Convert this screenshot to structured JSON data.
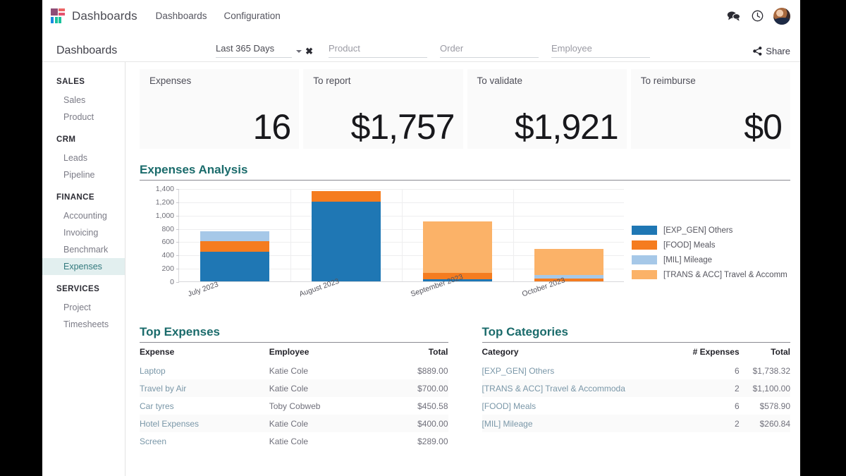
{
  "topbar": {
    "logo_icon": "dashboards-logo-icon",
    "brand": "Dashboards",
    "menu": [
      {
        "label": "Dashboards"
      },
      {
        "label": "Configuration"
      }
    ],
    "icons": [
      {
        "name": "messages-icon",
        "glyph": "speech-bubbles"
      },
      {
        "name": "activity-clock-icon",
        "glyph": "clock"
      }
    ],
    "avatar": "user-avatar"
  },
  "controlbar": {
    "page_title": "Dashboards",
    "filters": [
      {
        "name": "date-range",
        "value": "Last 365 Days",
        "caret": "chevron-down-icon",
        "clear": "✖"
      },
      {
        "name": "product",
        "placeholder": "Product"
      },
      {
        "name": "order",
        "placeholder": "Order"
      },
      {
        "name": "employee",
        "placeholder": "Employee"
      }
    ],
    "share_label": "Share",
    "share_icon": "share-icon"
  },
  "sidebar": {
    "groups": [
      {
        "title": "SALES",
        "items": [
          {
            "label": "Sales",
            "active": false
          },
          {
            "label": "Product",
            "active": false
          }
        ]
      },
      {
        "title": "CRM",
        "items": [
          {
            "label": "Leads",
            "active": false
          },
          {
            "label": "Pipeline",
            "active": false
          }
        ]
      },
      {
        "title": "FINANCE",
        "items": [
          {
            "label": "Accounting",
            "active": false
          },
          {
            "label": "Invoicing",
            "active": false
          },
          {
            "label": "Benchmark",
            "active": false
          },
          {
            "label": "Expenses",
            "active": true
          }
        ]
      },
      {
        "title": "SERVICES",
        "items": [
          {
            "label": "Project",
            "active": false
          },
          {
            "label": "Timesheets",
            "active": false
          }
        ]
      }
    ]
  },
  "kpis": [
    {
      "label": "Expenses",
      "value": "16"
    },
    {
      "label": "To report",
      "value": "$1,757"
    },
    {
      "label": "To validate",
      "value": "$1,921"
    },
    {
      "label": "To reimburse",
      "value": "$0"
    }
  ],
  "sections": {
    "expenses_analysis": "Expenses Analysis",
    "top_expenses": "Top Expenses",
    "top_categories": "Top Categories"
  },
  "chart_data": {
    "type": "bar",
    "title": "Expenses Analysis",
    "stacked": true,
    "xlabel": "",
    "ylabel": "",
    "ylim": [
      0,
      1400
    ],
    "yticks": [
      0,
      200,
      400,
      600,
      800,
      1000,
      1200,
      1400
    ],
    "ytick_labels": [
      "0",
      "200",
      "400",
      "600",
      "800",
      "1,000",
      "1,200",
      "1,400"
    ],
    "grid": true,
    "legend_position": "right",
    "categories": [
      "July 2023",
      "August 2023",
      "September 2023",
      "October 2023"
    ],
    "series": [
      {
        "name": "[EXP_GEN] Others",
        "color": "#1f77b4",
        "values": [
          448,
          1200,
          30,
          0
        ]
      },
      {
        "name": "[FOOD] Meals",
        "color": "#f57c1f",
        "values": [
          158,
          155,
          100,
          45
        ]
      },
      {
        "name": "[MIL] Mileage",
        "color": "#a6c8e8",
        "values": [
          150,
          0,
          0,
          55
        ]
      },
      {
        "name": "[TRANS & ACC] Travel & Accomm",
        "color": "#fbb268",
        "values": [
          0,
          0,
          770,
          390
        ]
      }
    ],
    "totals": [
      756,
      1355,
      900,
      490
    ]
  },
  "top_expenses": {
    "columns": [
      "Expense",
      "Employee",
      "Total"
    ],
    "rows": [
      [
        "Laptop",
        "Katie Cole",
        "$889.00"
      ],
      [
        "Travel by Air",
        "Katie Cole",
        "$700.00"
      ],
      [
        "Car tyres",
        "Toby Cobweb",
        "$450.58"
      ],
      [
        "Hotel Expenses",
        "Katie Cole",
        "$400.00"
      ],
      [
        "Screen",
        "Katie Cole",
        "$289.00"
      ]
    ]
  },
  "top_categories": {
    "columns": [
      "Category",
      "# Expenses",
      "Total"
    ],
    "rows": [
      [
        "[EXP_GEN] Others",
        "6",
        "$1,738.32"
      ],
      [
        "[TRANS & ACC] Travel & Accommoda",
        "2",
        "$1,100.00"
      ],
      [
        "[FOOD] Meals",
        "6",
        "$578.90"
      ],
      [
        "[MIL] Mileage",
        "2",
        "$260.84"
      ]
    ]
  },
  "colors": {
    "accent_teal": "#1a6b6b",
    "sidebar_active_bg": "#e2efef",
    "sidebar_active_fg": "#33797d"
  }
}
